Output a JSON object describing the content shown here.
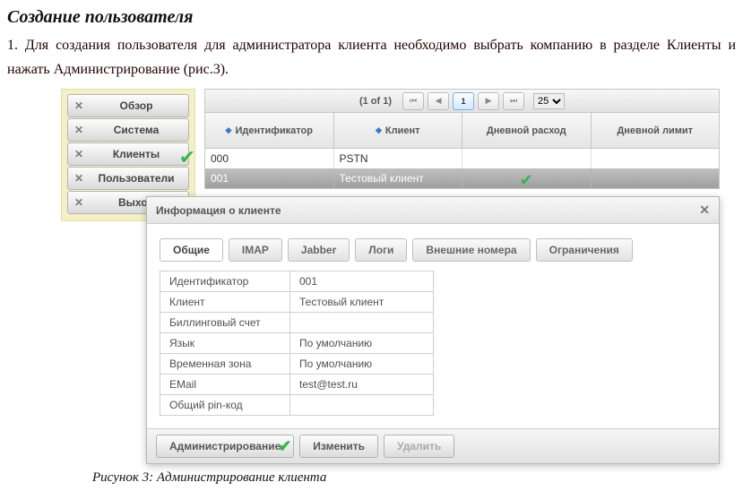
{
  "doc": {
    "heading": "Создание пользователя",
    "paragraph": "1. Для создания пользователя для администратора клиента необходимо выбрать компанию в разделе Клиенты и нажать Администрирование (рис.3).",
    "caption": "Рисунок 3: Администрирование клиента"
  },
  "nav": {
    "items": [
      "Обзор",
      "Система",
      "Клиенты",
      "Пользователи",
      "Выход"
    ],
    "selected_index": 2
  },
  "paginator": {
    "text": "(1 of 1)",
    "current": "1",
    "page_size": "25"
  },
  "grid": {
    "headers": [
      "Идентификатор",
      "Клиент",
      "Дневной расход",
      "Дневной лимит"
    ],
    "rows": [
      {
        "id": "000",
        "client": "PSTN",
        "spend": "",
        "limit": "",
        "selected": false
      },
      {
        "id": "001",
        "client": "Тестовый клиент",
        "spend": "",
        "limit": "",
        "selected": true
      }
    ]
  },
  "dialog": {
    "title": "Информация о клиенте",
    "tabs": [
      "Общие",
      "IMAP",
      "Jabber",
      "Логи",
      "Внешние номера",
      "Ограничения"
    ],
    "active_tab": 0,
    "fields": [
      {
        "k": "Идентификатор",
        "v": "001"
      },
      {
        "k": "Клиент",
        "v": "Тестовый клиент"
      },
      {
        "k": "Биллинговый счет",
        "v": ""
      },
      {
        "k": "Язык",
        "v": "По умолчанию"
      },
      {
        "k": "Временная зона",
        "v": "По умолчанию"
      },
      {
        "k": "EMail",
        "v": "test@test.ru"
      },
      {
        "k": "Общий pin-код",
        "v": ""
      }
    ],
    "buttons": {
      "admin": "Администрирование",
      "edit": "Изменить",
      "delete": "Удалить"
    }
  }
}
